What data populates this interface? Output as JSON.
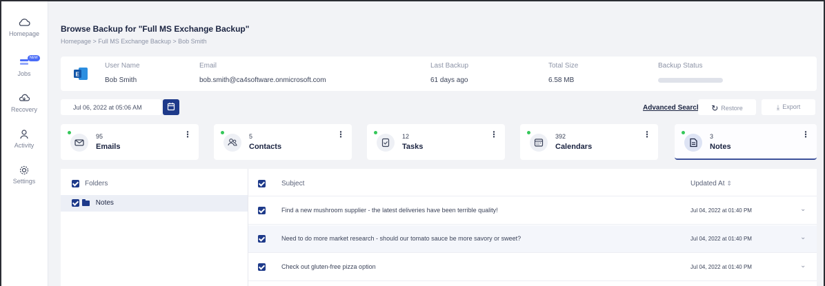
{
  "sidebar": {
    "items": [
      {
        "label": "Homepage",
        "icon": "cloud-icon"
      },
      {
        "label": "Jobs",
        "icon": "jobs-icon",
        "badge": "NEW"
      },
      {
        "label": "Recovery",
        "icon": "recovery-icon"
      },
      {
        "label": "Activity",
        "icon": "activity-icon"
      },
      {
        "label": "Settings",
        "icon": "gear-icon"
      }
    ]
  },
  "header": {
    "title": "Browse Backup for \"Full MS Exchange Backup\"",
    "breadcrumb": "Homepage > Full MS Exchange Backup > Bob Smith"
  },
  "info": {
    "user_name_label": "User Name",
    "user_name": "Bob Smith",
    "email_label": "Email",
    "email": "bob.smith@ca4software.onmicrosoft.com",
    "last_backup_label": "Last Backup",
    "last_backup": "61 days ago",
    "total_size_label": "Total Size",
    "total_size": "6.58 MB",
    "backup_status_label": "Backup Status"
  },
  "toolbar": {
    "date": "Jul 06, 2022 at 05:06 AM",
    "advanced_search": "Advanced Search",
    "restore": "Restore",
    "export": "Export"
  },
  "stats": [
    {
      "count": "95",
      "label": "Emails",
      "icon": "mail-icon"
    },
    {
      "count": "5",
      "label": "Contacts",
      "icon": "contacts-icon"
    },
    {
      "count": "12",
      "label": "Tasks",
      "icon": "tasks-icon"
    },
    {
      "count": "392",
      "label": "Calendars",
      "icon": "calendar-icon"
    },
    {
      "count": "3",
      "label": "Notes",
      "icon": "notes-icon",
      "active": true
    }
  ],
  "folders": {
    "header": "Folders",
    "items": [
      {
        "label": "Notes"
      }
    ]
  },
  "messages": {
    "subject_header": "Subject",
    "updated_header": "Updated At",
    "rows": [
      {
        "subject": "Find a new mushroom supplier - the latest deliveries have been terrible quality!",
        "updated": "Jul 04, 2022 at 01:40 PM"
      },
      {
        "subject": "Need to do more market research - should our tomato sauce be more savory or sweet?",
        "updated": "Jul 04, 2022 at 01:40 PM"
      },
      {
        "subject": "Check out gluten-free pizza option",
        "updated": "Jul 04, 2022 at 01:40 PM"
      }
    ]
  },
  "colors": {
    "accent": "#1e3a8a",
    "status_dot": "#34c759",
    "background": "#f2f3f6"
  }
}
